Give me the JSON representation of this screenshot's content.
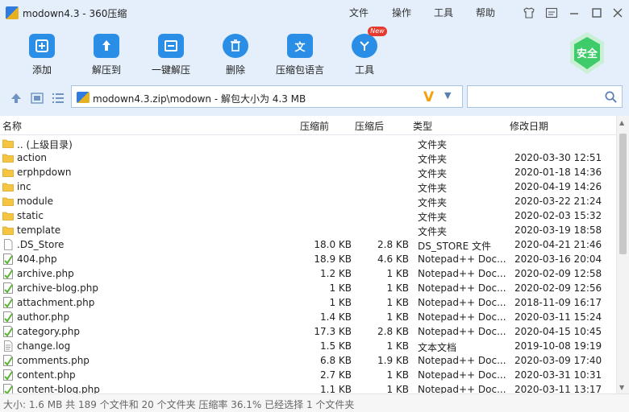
{
  "window": {
    "title": "modown4.3 - 360压缩",
    "menu": [
      "文件",
      "操作",
      "工具",
      "帮助"
    ]
  },
  "toolbar": {
    "items": [
      {
        "label": "添加",
        "icon": "add-icon"
      },
      {
        "label": "解压到",
        "icon": "extract-to-icon"
      },
      {
        "label": "一键解压",
        "icon": "one-click-extract-icon"
      },
      {
        "label": "删除",
        "icon": "trash-icon"
      },
      {
        "label": "压缩包语言",
        "icon": "language-icon"
      },
      {
        "label": "工具",
        "icon": "tools-icon"
      }
    ],
    "new_badge": "New",
    "safe_label": "安全",
    "accent": "#2a8ee6",
    "safe_color": "#3ecb6a"
  },
  "address": {
    "path": "modown4.3.zip\\modown - 解包大小为 4.3 MB"
  },
  "columns": {
    "name": "名称",
    "size": "压缩前",
    "compressed": "压缩后",
    "type": "类型",
    "date": "修改日期"
  },
  "files": [
    {
      "name": ".. (上级目录)",
      "size": "",
      "comp": "",
      "type": "文件夹",
      "date": "",
      "kind": "folder"
    },
    {
      "name": "action",
      "size": "",
      "comp": "",
      "type": "文件夹",
      "date": "2020-03-30 12:51",
      "kind": "folder"
    },
    {
      "name": "erphpdown",
      "size": "",
      "comp": "",
      "type": "文件夹",
      "date": "2020-01-18 14:36",
      "kind": "folder"
    },
    {
      "name": "inc",
      "size": "",
      "comp": "",
      "type": "文件夹",
      "date": "2020-04-19 14:26",
      "kind": "folder"
    },
    {
      "name": "module",
      "size": "",
      "comp": "",
      "type": "文件夹",
      "date": "2020-03-22 21:24",
      "kind": "folder"
    },
    {
      "name": "static",
      "size": "",
      "comp": "",
      "type": "文件夹",
      "date": "2020-02-03 15:32",
      "kind": "folder"
    },
    {
      "name": "template",
      "size": "",
      "comp": "",
      "type": "文件夹",
      "date": "2020-03-19 18:58",
      "kind": "folder"
    },
    {
      "name": ".DS_Store",
      "size": "18.0 KB",
      "comp": "2.8 KB",
      "type": "DS_STORE 文件",
      "date": "2020-04-21 21:46",
      "kind": "blank"
    },
    {
      "name": "404.php",
      "size": "18.9 KB",
      "comp": "4.6 KB",
      "type": "Notepad++ Doc...",
      "date": "2020-03-16 20:04",
      "kind": "php"
    },
    {
      "name": "archive.php",
      "size": "1.2 KB",
      "comp": "1 KB",
      "type": "Notepad++ Doc...",
      "date": "2020-02-09 12:58",
      "kind": "php"
    },
    {
      "name": "archive-blog.php",
      "size": "1 KB",
      "comp": "1 KB",
      "type": "Notepad++ Doc...",
      "date": "2020-02-09 12:56",
      "kind": "php"
    },
    {
      "name": "attachment.php",
      "size": "1 KB",
      "comp": "1 KB",
      "type": "Notepad++ Doc...",
      "date": "2018-11-09 16:17",
      "kind": "php"
    },
    {
      "name": "author.php",
      "size": "1.4 KB",
      "comp": "1 KB",
      "type": "Notepad++ Doc...",
      "date": "2020-03-11 15:24",
      "kind": "php"
    },
    {
      "name": "category.php",
      "size": "17.3 KB",
      "comp": "2.8 KB",
      "type": "Notepad++ Doc...",
      "date": "2020-04-15 10:45",
      "kind": "php"
    },
    {
      "name": "change.log",
      "size": "1.5 KB",
      "comp": "1 KB",
      "type": "文本文档",
      "date": "2019-10-08 19:19",
      "kind": "text"
    },
    {
      "name": "comments.php",
      "size": "6.8 KB",
      "comp": "1.9 KB",
      "type": "Notepad++ Doc...",
      "date": "2020-03-09 17:40",
      "kind": "php"
    },
    {
      "name": "content.php",
      "size": "2.7 KB",
      "comp": "1 KB",
      "type": "Notepad++ Doc...",
      "date": "2020-03-31 10:31",
      "kind": "php"
    },
    {
      "name": "content-blog.php",
      "size": "1.1 KB",
      "comp": "1 KB",
      "type": "Notepad++ Doc...",
      "date": "2020-03-11 13:17",
      "kind": "php"
    }
  ],
  "status": {
    "text": "大小: 1.6 MB 共 189 个文件和 20 个文件夹 压缩率 36.1% 已经选择 1 个文件夹"
  }
}
